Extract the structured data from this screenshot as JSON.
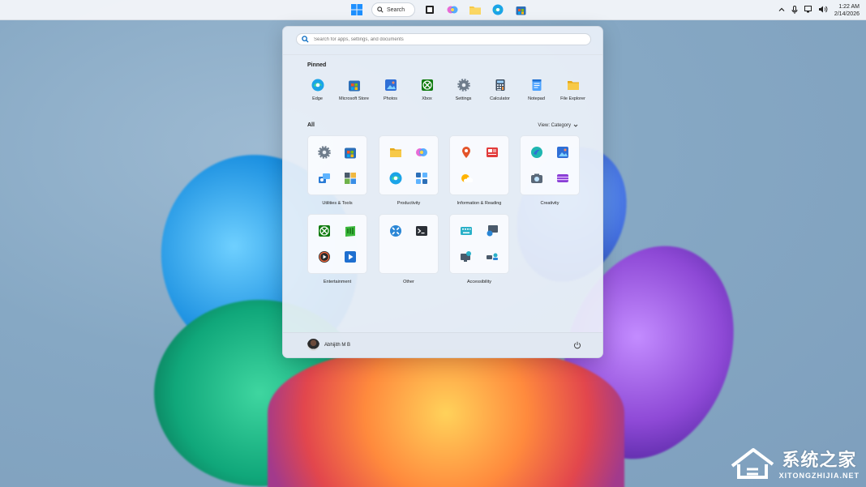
{
  "taskbar": {
    "search_label": "Search",
    "clock_time": "1:22 AM",
    "clock_date": "2/14/2026"
  },
  "start_menu": {
    "search_placeholder": "Search for apps, settings, and documents",
    "pinned_title": "Pinned",
    "pinned": [
      {
        "label": "Edge",
        "icon": "edge-icon"
      },
      {
        "label": "Microsoft Store",
        "icon": "store-icon"
      },
      {
        "label": "Photos",
        "icon": "photos-icon"
      },
      {
        "label": "Xbox",
        "icon": "xbox-icon"
      },
      {
        "label": "Settings",
        "icon": "gear-icon"
      },
      {
        "label": "Calculator",
        "icon": "calculator-icon"
      },
      {
        "label": "Notepad",
        "icon": "notepad-icon"
      },
      {
        "label": "File Explorer",
        "icon": "folder-icon"
      }
    ],
    "all_title": "All",
    "view_label": "View: Category",
    "categories": [
      {
        "label": "Utilities & Tools"
      },
      {
        "label": "Productivity"
      },
      {
        "label": "Information & Reading"
      },
      {
        "label": "Creativity"
      },
      {
        "label": "Entertainment"
      },
      {
        "label": "Other"
      },
      {
        "label": "Accessibility"
      }
    ],
    "user_name": "Abhijith M B"
  },
  "watermark": {
    "cn": "系统之家",
    "en": "XITONGZHIJIA.NET"
  },
  "colors": {
    "accent": "#0067c0",
    "edge": "#1ba4e8",
    "xbox": "#107c10",
    "folder": "#f7c948"
  }
}
